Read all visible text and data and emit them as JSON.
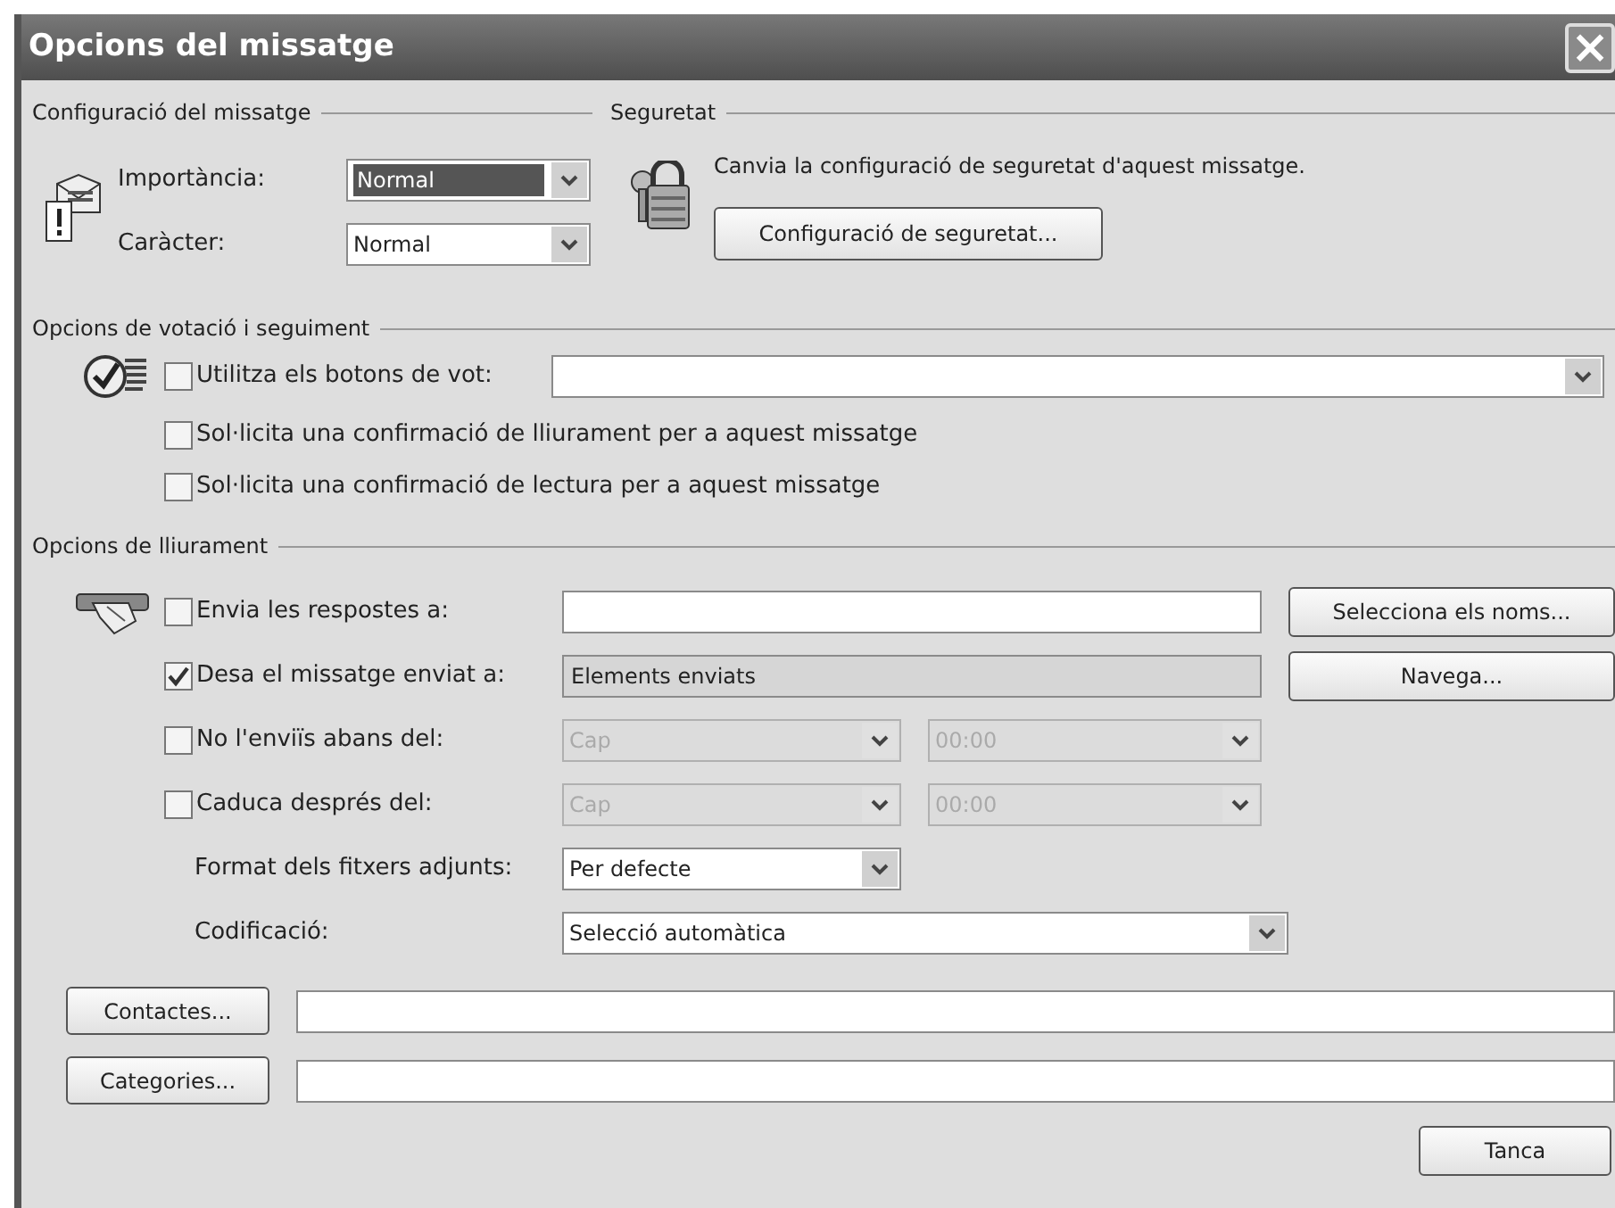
{
  "window": {
    "title": "Opcions del missatge",
    "close": "×"
  },
  "message_settings": {
    "heading": "Configuració del missatge",
    "fields": [
      {
        "label": "Importància:",
        "value": "Normal",
        "focused": true
      },
      {
        "label": "Caràcter:",
        "value": "Normal",
        "focused": false
      }
    ]
  },
  "security": {
    "heading": "Seguretat",
    "text": "Canvia la configuració de seguretat d'aquest missatge.",
    "button": "Configuració de seguretat..."
  },
  "voting": {
    "heading": "Opcions de votació i seguiment",
    "options": [
      {
        "kind": "combo",
        "label": "Utilitza els botons de vot:",
        "checked": false
      },
      {
        "kind": "plain",
        "label": "Sol·licita una confirmació de lliurament per a aquest missatge",
        "checked": false
      },
      {
        "kind": "plain",
        "label": "Sol·licita una confirmació de lectura per a aquest missatge",
        "checked": false
      }
    ]
  },
  "delivery": {
    "heading": "Opcions de lliurament",
    "options": [
      {
        "kind": "field",
        "label": "Envia les respostes a:",
        "checked": false,
        "disabled": false,
        "button": "Selecciona els noms..."
      },
      {
        "kind": "field",
        "label": "Desa el missatge enviat a:",
        "checked": true,
        "value": "Elements enviats",
        "disabled": true,
        "button": "Navega..."
      },
      {
        "kind": "datetime",
        "label": "No l'enviïs abans del:",
        "checked": false,
        "date": "Cap",
        "time": "00:00",
        "disabled": true
      },
      {
        "kind": "datetime",
        "label": "Caduca després del:",
        "checked": false,
        "date": "Cap",
        "time": "00:00",
        "disabled": true
      },
      {
        "kind": "select_short",
        "label": "Format dels fitxers adjunts:",
        "value": "Per defecte"
      },
      {
        "kind": "select_long",
        "label": "Codificació:",
        "value": "Selecció automàtica"
      }
    ]
  },
  "bottom_fields": [
    {
      "button": "Contactes..."
    },
    {
      "button": "Categories..."
    }
  ],
  "buttons": [
    "Tanca"
  ]
}
